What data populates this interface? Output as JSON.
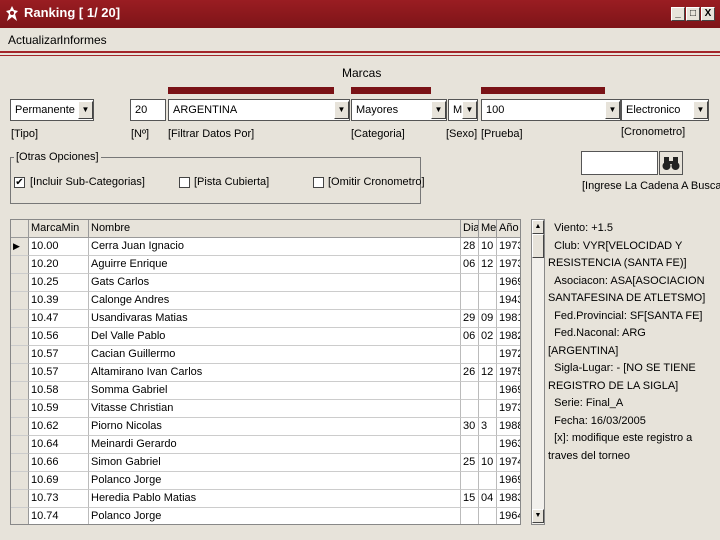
{
  "window": {
    "title": "Ranking [ 1/ 20]",
    "buttons": [
      "_",
      "□",
      "X"
    ]
  },
  "menu": [
    "Actualizar",
    "Informes"
  ],
  "section_title": "Marcas",
  "filters": {
    "tipo": {
      "value": "Permanente",
      "label": "[Tipo]"
    },
    "numero": {
      "value": "20",
      "label": "[Nº]"
    },
    "filtrar": {
      "value": "ARGENTINA",
      "label": "[Filtrar Datos Por]"
    },
    "categoria": {
      "value": "Mayores",
      "label": "[Categoria]"
    },
    "sexo": {
      "value": "M",
      "label": "[Sexo]"
    },
    "prueba": {
      "value": "100",
      "label": "[Prueba]"
    },
    "cronometro": {
      "value": "Electronico",
      "label": "[Cronometro]"
    }
  },
  "otras": {
    "legend": "[Otras Opciones]",
    "options": [
      {
        "label": "[Incluir Sub-Categorias]",
        "checked": true
      },
      {
        "label": "[Pista Cubierta]",
        "checked": false
      },
      {
        "label": "[Omitir Cronometro]",
        "checked": false
      }
    ]
  },
  "search": {
    "value": "",
    "label": "[Ingrese La Cadena A Buscar]",
    "icon": "binoculars-icon"
  },
  "grid": {
    "columns": [
      "MarcaMin",
      "Nombre",
      "Dia",
      "Mes",
      "Año"
    ],
    "rows": [
      [
        "10.00",
        "Cerra Juan Ignacio",
        "28",
        "10",
        "1973"
      ],
      [
        "10.20",
        "Aguirre Enrique",
        "06",
        "12",
        "1973"
      ],
      [
        "10.25",
        "Gats Carlos",
        "",
        "",
        "1969"
      ],
      [
        "10.39",
        "Calonge Andres",
        "",
        "",
        "1943"
      ],
      [
        "10.47",
        "Usandivaras Matias",
        "29",
        "09",
        "1981"
      ],
      [
        "10.56",
        "Del Valle Pablo",
        "06",
        "02",
        "1982"
      ],
      [
        "10.57",
        "Cacian Guillermo",
        "",
        "",
        "1972"
      ],
      [
        "10.57",
        "Altamirano Ivan Carlos",
        "26",
        "12",
        "1975"
      ],
      [
        "10.58",
        "Somma Gabriel",
        "",
        "",
        "1969"
      ],
      [
        "10.59",
        "Vitasse Christian",
        "",
        "",
        "1973"
      ],
      [
        "10.62",
        "Piorno Nicolas",
        "30",
        "3",
        "1988"
      ],
      [
        "10.64",
        "Meinardi Gerardo",
        "",
        "",
        "1963"
      ],
      [
        "10.66",
        "Simon Gabriel",
        "25",
        "10",
        "1974"
      ],
      [
        "10.69",
        "Polanco Jorge",
        "",
        "",
        "1969"
      ],
      [
        "10.73",
        "Heredia Pablo Matias",
        "15",
        "04",
        "1983"
      ],
      [
        "10.74",
        "Polanco Jorge",
        "",
        "",
        "1964"
      ]
    ]
  },
  "details": [
    "  Viento: +1.5",
    "  Club: VYR[VELOCIDAD Y\nRESISTENCIA (SANTA FE)]",
    "  Asociacon: ASA[ASOCIACION\nSANTAFESINA DE ATLETSMO]",
    "  Fed.Provincial: SF[SANTA FE]",
    "  Fed.Naconal: ARG [ARGENTINA]",
    "  Sigla-Lugar: - [NO SE TIENE\nREGISTRO DE LA SIGLA]",
    "  Serie: Final_A",
    "  Fecha: 16/03/2005",
    "  [x]: modifique este registro a\ntraves del torneo"
  ]
}
